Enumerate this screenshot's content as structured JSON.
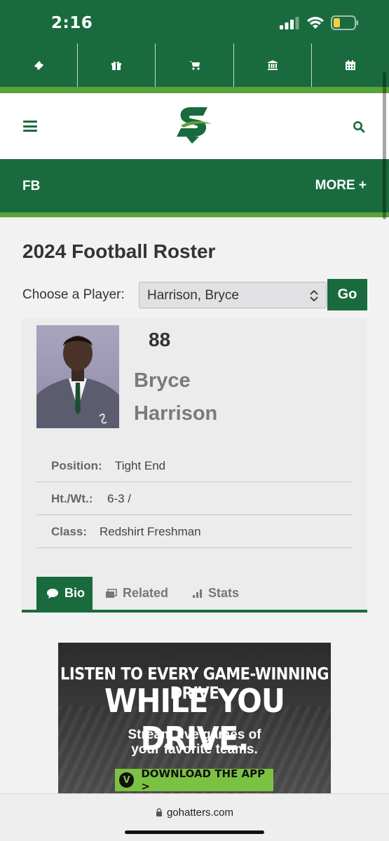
{
  "status_bar": {
    "time": "2:16"
  },
  "utility_bar": {
    "items": [
      "ticket-icon",
      "gift-icon",
      "cart-icon",
      "bank-icon",
      "calendar-icon"
    ]
  },
  "header": {
    "menu_icon": "hamburger-icon",
    "search_icon": "search-icon"
  },
  "sport_nav": {
    "sport": "FB",
    "more": "MORE +"
  },
  "page": {
    "title": "2024 Football Roster",
    "choose_label": "Choose a Player:",
    "selected_player": "Harrison, Bryce",
    "go_label": "Go"
  },
  "player": {
    "number": "88",
    "first_name": "Bryce",
    "last_name": "Harrison",
    "position_label": "Position:",
    "position": "Tight End",
    "htwt_label": "Ht./Wt.:",
    "htwt": "6-3 /",
    "class_label": "Class:",
    "class": "Redshirt Freshman"
  },
  "tabs": [
    {
      "label": "Bio",
      "icon": "chat-icon",
      "active": true
    },
    {
      "label": "Related",
      "icon": "images-icon",
      "active": false
    },
    {
      "label": "Stats",
      "icon": "bar-chart-icon",
      "active": false
    }
  ],
  "ad": {
    "line1": "LISTEN TO EVERY GAME-WINNING DRIVE",
    "line2": "WHILE YOU DRIVE.",
    "line3a": "Stream live games of",
    "line3b": "your favorite teams.",
    "cta": "DOWNLOAD THE APP >",
    "badge": "V"
  },
  "browser": {
    "url": "gohatters.com"
  },
  "colors": {
    "brand_green": "#196b3e",
    "accent_green": "#59a33a",
    "ad_green": "#7cc242"
  }
}
